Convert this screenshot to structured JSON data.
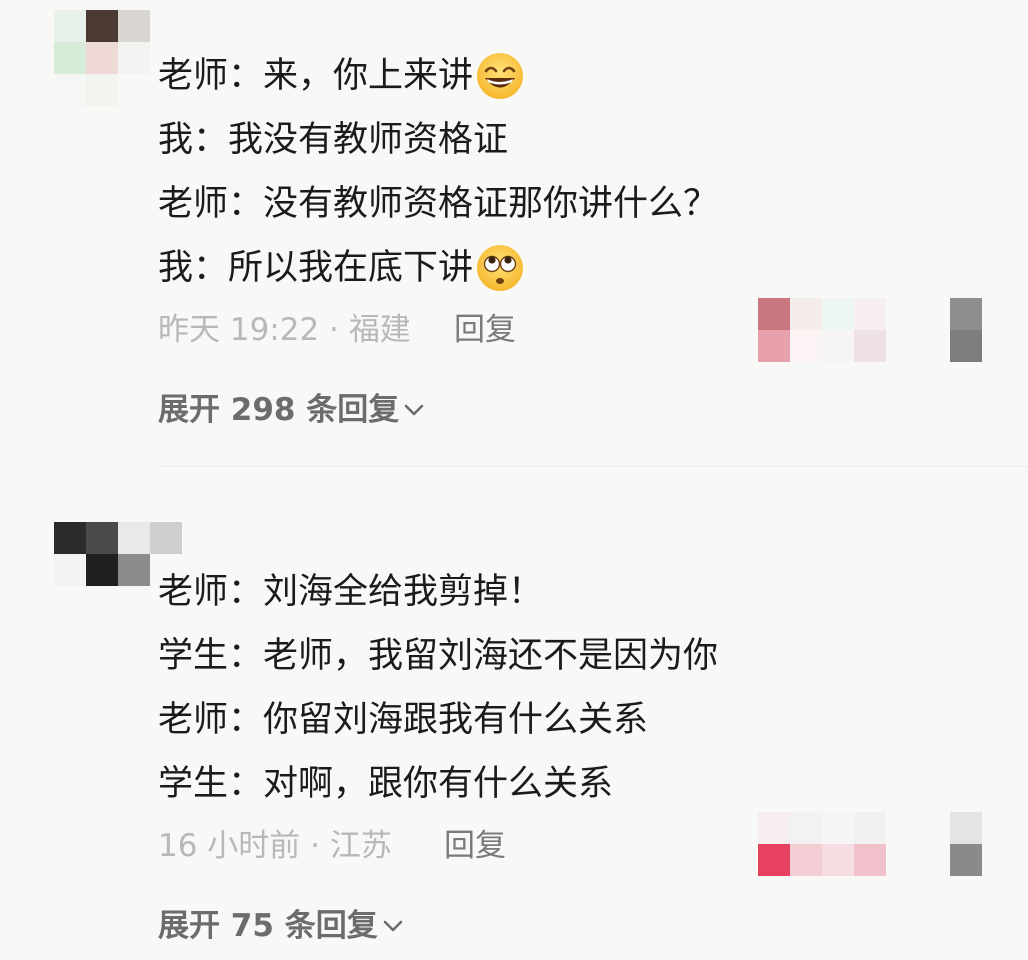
{
  "comments": [
    {
      "lines": [
        "老师：来，你上来讲",
        "我：我没有教师资格证",
        "老师：没有教师资格证那你讲什么？",
        "我：所以我在底下讲"
      ],
      "line_emojis": [
        "grinning-squint-face",
        null,
        null,
        "pleading-eyes-face"
      ],
      "time_location": "昨天 19:22 · 福建",
      "reply_label": "回复",
      "expand_label": "展开 298 条回复"
    },
    {
      "lines": [
        "老师：刘海全给我剪掉！",
        "学生：老师，我留刘海还不是因为你",
        "老师：你留刘海跟我有什么关系",
        "学生：对啊，跟你有什么关系"
      ],
      "line_emojis": [
        null,
        null,
        null,
        null
      ],
      "time_location": "16 小时前 · 江苏",
      "reply_label": "回复",
      "expand_label": "展开 75 条回复"
    }
  ],
  "colors": {
    "background": "#f8f8f7",
    "text_primary": "#1b1b1b",
    "text_meta": "#b8b8b8",
    "text_reply": "#7a7a7a",
    "text_expand": "#6c6c6c"
  }
}
